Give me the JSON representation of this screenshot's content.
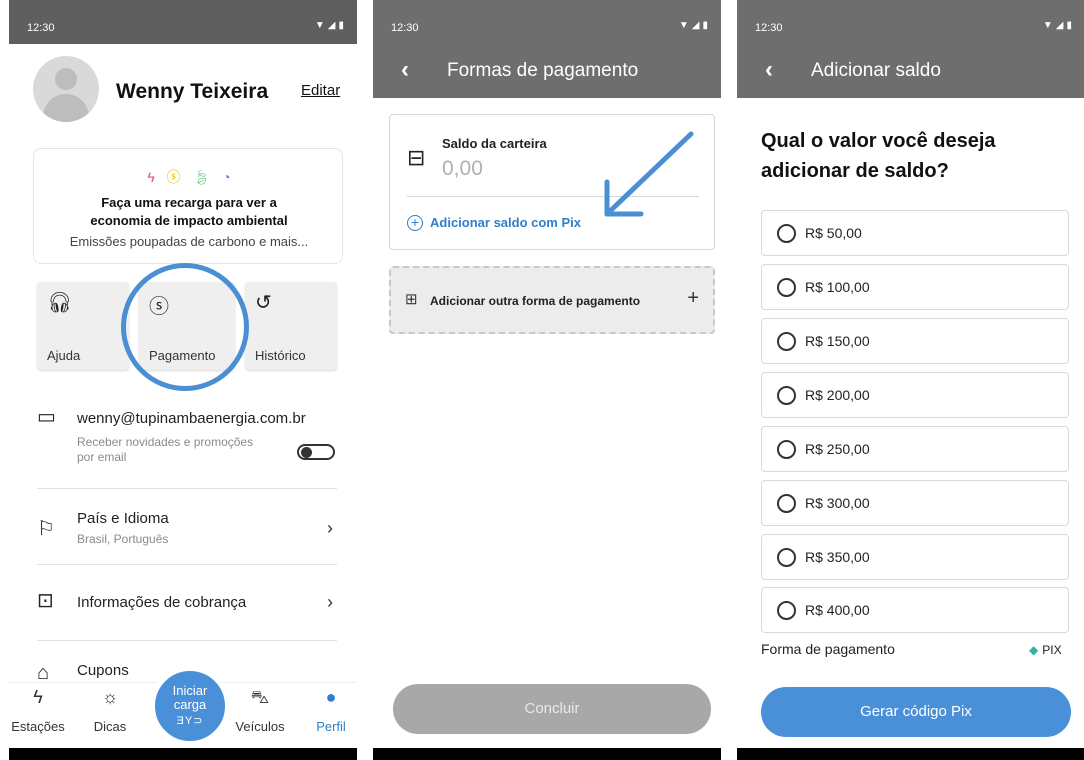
{
  "status": {
    "time": "12:30"
  },
  "profile": {
    "user_name": "Wenny Teixeira",
    "edit_label": "Editar",
    "eco_card": {
      "icons": [
        "lightning-icon",
        "coin-icon",
        "leaf-icon",
        "gauge-icon"
      ],
      "title_line1": "Faça uma recarga para ver a",
      "title_line2": "economia de impacto ambiental",
      "subtitle": "Emissões poupadas de carbono e mais..."
    },
    "tiles": [
      {
        "label": "Ajuda",
        "icon": "headset-icon"
      },
      {
        "label": "Pagamento",
        "icon": "dollar-circle-icon"
      },
      {
        "label": "Histórico",
        "icon": "history-icon"
      }
    ],
    "email": "wenny@tupinambaenergia.com.br",
    "email_sub_line1": "Receber novidades e promoções",
    "email_sub_line2": "por email",
    "country": {
      "title": "País e Idioma",
      "sub": "Brasil, Português"
    },
    "billing": {
      "title": "Informações de cobrança"
    },
    "coupons": {
      "title": "Cupons"
    },
    "tabs": {
      "stations": "Estações",
      "tips": "Dicas",
      "start_line1": "Iniciar",
      "start_line2": "carga",
      "brand": "ƎY⊃",
      "vehicles": "Veículos",
      "profile": "Perfil"
    },
    "colors": {
      "accent": "#4a90d9",
      "active_tab": "#2f7fc9"
    }
  },
  "payment_methods": {
    "title": "Formas de pagamento",
    "wallet_title": "Saldo da carteira",
    "wallet_balance": "0,00",
    "add_pix_label": "Adicionar saldo com Pix",
    "add_other_label": "Adicionar outra forma de pagamento",
    "confirm_label": "Concluir"
  },
  "add_balance": {
    "title": "Adicionar saldo",
    "question": "Qual o valor você deseja adicionar de saldo?",
    "options": [
      "R$ 50,00",
      "R$ 100,00",
      "R$ 150,00",
      "R$ 200,00",
      "R$ 250,00",
      "R$ 300,00",
      "R$ 350,00",
      "R$ 400,00"
    ],
    "payment_form_label": "Forma de pagamento",
    "payment_method": "PIX",
    "generate_label": "Gerar código Pix"
  }
}
